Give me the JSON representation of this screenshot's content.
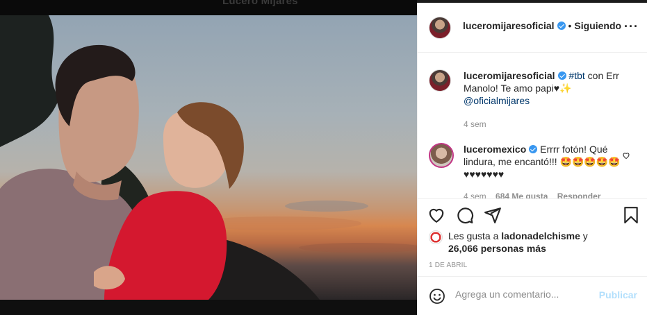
{
  "background": {
    "owner_name": "Lucero Mijares"
  },
  "post": {
    "username": "luceromijaresoficial",
    "follow_status": "Siguiendo",
    "separator": "•",
    "more_icon": "more-horizontal-icon"
  },
  "caption": {
    "username": "luceromijaresoficial",
    "hashtag": "#tbt",
    "text": " con Err Manolo! Te amo papi♥✨",
    "mention": "@oficialmijares",
    "age": "4 sem"
  },
  "comments": [
    {
      "username": "luceromexico",
      "text": " Errrr fotón! Qué lindura, me encantó!!! 🤩🤩🤩🤩🤩 ♥♥♥♥♥♥♥",
      "age": "4 sem",
      "likes": "684 Me gusta",
      "reply": "Responder"
    }
  ],
  "actions": {
    "like_icon": "heart-icon",
    "comment_icon": "comment-icon",
    "share_icon": "paper-plane-icon",
    "save_icon": "bookmark-icon"
  },
  "likes": {
    "prefix": "Les gusta a ",
    "user": "ladonadelchisme",
    "connector": " y",
    "count": "26,066 personas más"
  },
  "date": "1 DE ABRIL",
  "add_comment": {
    "placeholder": "Agrega un comentario...",
    "post_label": "Publicar"
  },
  "colors": {
    "link": "#00376b",
    "verified": "#3897f0",
    "muted": "#8e8e8e",
    "publish_disabled": "#b2dffc",
    "story_ring": "#c13584"
  }
}
